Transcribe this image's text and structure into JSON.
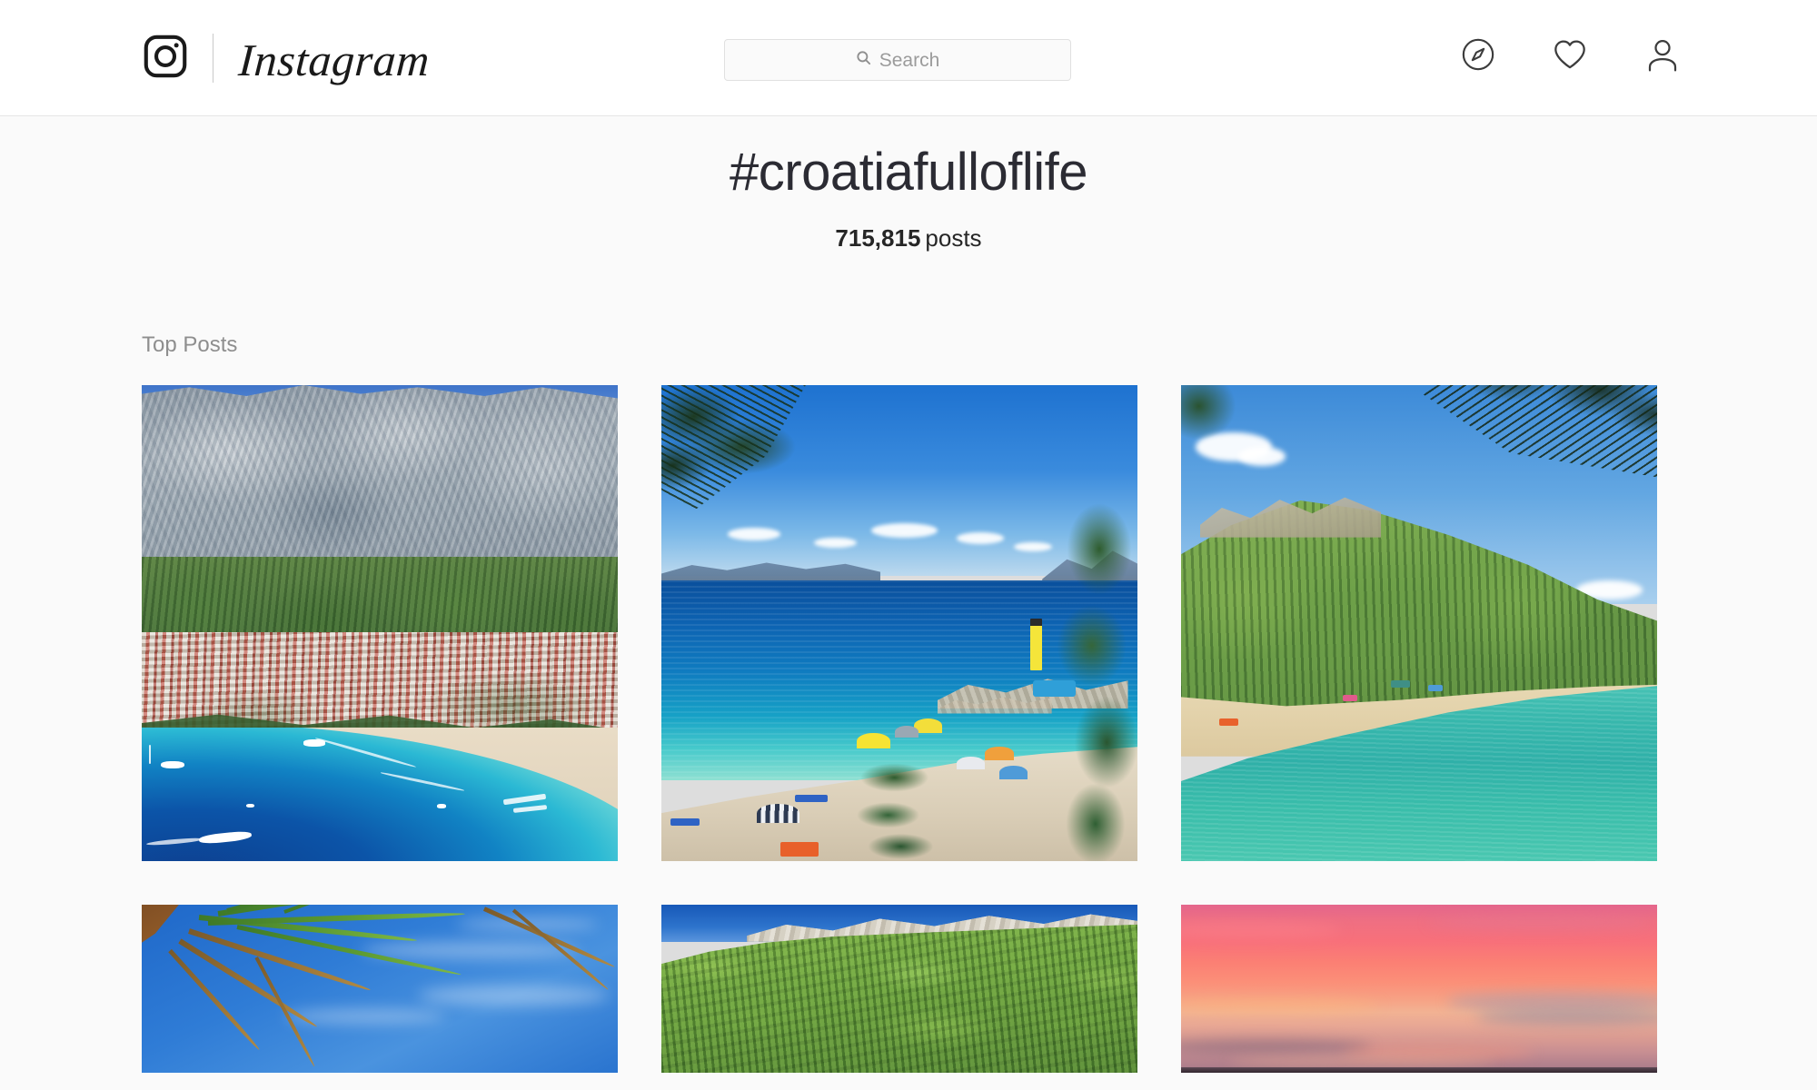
{
  "header": {
    "logo_icon": "instagram-camera-icon",
    "wordmark": "Instagram",
    "search": {
      "icon": "search-icon",
      "placeholder": "Search",
      "value": ""
    },
    "nav": [
      {
        "icon": "compass-icon",
        "label": "Explore"
      },
      {
        "icon": "heart-icon",
        "label": "Activity"
      },
      {
        "icon": "person-icon",
        "label": "Profile"
      }
    ]
  },
  "hashtag": {
    "title": "#croatiafulloflife",
    "count": "715,815",
    "count_label": "posts"
  },
  "section": {
    "top_posts_label": "Top Posts"
  },
  "grid": {
    "rows": [
      {
        "tiles": [
          {
            "alt": "Aerial view of Makarska town and bay with mountains"
          },
          {
            "alt": "Pebble beach with umbrellas and blue Adriatic sea"
          },
          {
            "alt": "Forested cove with turquoise water and sandy beach"
          }
        ]
      },
      {
        "tiles": [
          {
            "alt": "Palm fronds against a blue sky"
          },
          {
            "alt": "Green pine forest with limestone cliffs"
          },
          {
            "alt": "Pink and coral sunset sky"
          }
        ]
      }
    ]
  },
  "colors": {
    "page_bg": "#fafafa",
    "header_bg": "#ffffff",
    "border": "#e6e6e6",
    "text_primary": "#262626",
    "text_muted": "#8e8e8e",
    "placeholder": "#9b9b9b"
  }
}
